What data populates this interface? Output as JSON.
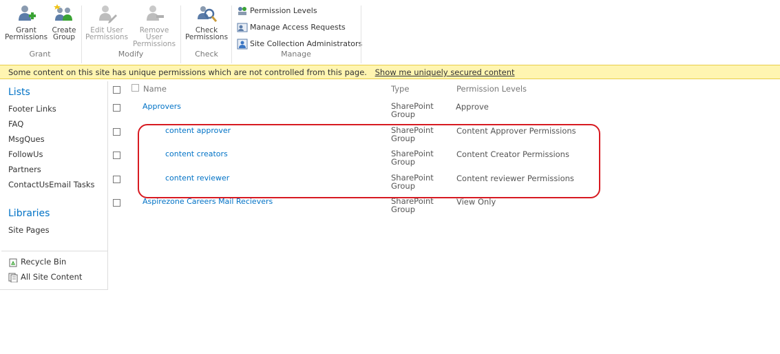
{
  "ribbon": {
    "grant": {
      "label": "Grant",
      "grant_permissions": [
        "Grant",
        "Permissions"
      ],
      "create_group": [
        "Create",
        "Group"
      ]
    },
    "modify": {
      "label": "Modify",
      "edit_user_permissions": [
        "Edit User",
        "Permissions"
      ],
      "remove_user_permissions": [
        "Remove User",
        "Permissions"
      ]
    },
    "check": {
      "label": "Check",
      "check_permissions": [
        "Check",
        "Permissions"
      ]
    },
    "manage": {
      "label": "Manage",
      "permission_levels": "Permission Levels",
      "manage_access_requests": "Manage Access Requests",
      "site_collection_administrators": "Site Collection Administrators"
    }
  },
  "status": {
    "message": "Some content on this site has unique permissions which are not controlled from this page.",
    "link": "Show me uniquely secured content"
  },
  "leftnav": {
    "lists_heading": "Lists",
    "lists": [
      "Footer Links",
      "FAQ",
      "MsgQues",
      "FollowUs",
      "Partners",
      "ContactUsEmail Tasks"
    ],
    "libraries_heading": "Libraries",
    "libraries": [
      "Site Pages"
    ],
    "recycle_bin": "Recycle Bin",
    "all_site_content": "All Site Content"
  },
  "table": {
    "columns": {
      "name": "Name",
      "type": "Type",
      "permission_levels": "Permission Levels"
    },
    "rows": [
      {
        "name": "Approvers",
        "type": [
          "SharePoint",
          "Group"
        ],
        "permission": "Approve"
      },
      {
        "name": "content approver",
        "type": [
          "SharePoint",
          "Group"
        ],
        "permission": "Content Approver Permissions"
      },
      {
        "name": "content creators",
        "type": [
          "SharePoint",
          "Group"
        ],
        "permission": "Content Creator Permissions"
      },
      {
        "name": "content reviewer",
        "type": [
          "SharePoint",
          "Group"
        ],
        "permission": "Content reviewer Permissions"
      },
      {
        "name": "Aspirezone Careers Mail Recievers",
        "type": [
          "SharePoint",
          "Group"
        ],
        "permission": "View Only"
      }
    ]
  },
  "colors": {
    "link": "#0072c6",
    "status_bg": "#fff5b1",
    "highlight": "#d71920"
  }
}
